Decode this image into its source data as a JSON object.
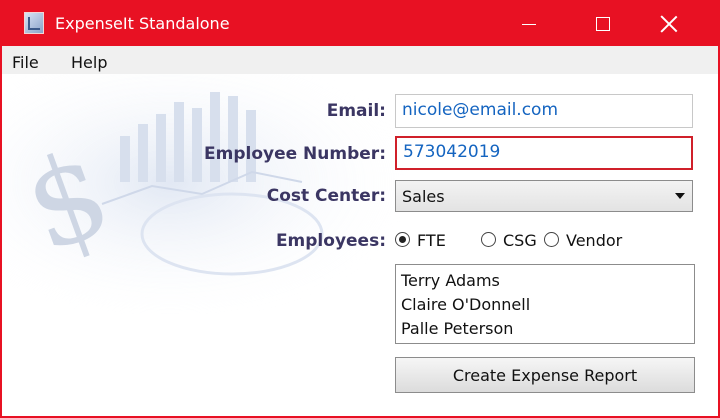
{
  "window": {
    "title": "ExpenseIt Standalone",
    "accent_color": "#e81123",
    "app_icon": "expenseit-app-icon",
    "controls": {
      "minimize": "minimize-icon",
      "maximize": "maximize-icon",
      "close": "close-icon"
    }
  },
  "menu": {
    "file": "File",
    "help": "Help"
  },
  "form": {
    "email_label": "Email:",
    "email_value": "nicole@email.com",
    "employee_number_label": "Employee Number:",
    "employee_number_value": "573042019",
    "cost_center_label": "Cost Center:",
    "cost_center_selected": "Sales",
    "employees_label": "Employees:",
    "employee_types": [
      {
        "label": "FTE",
        "checked": true
      },
      {
        "label": "CSG",
        "checked": false
      },
      {
        "label": "Vendor",
        "checked": false
      }
    ],
    "employee_list": [
      "Terry Adams",
      "Claire O'Donnell",
      "Palle Peterson"
    ],
    "create_button": "Create Expense Report"
  },
  "colors": {
    "label": "#3b3663",
    "input_text": "#1464c0",
    "focus_border": "#d0202a"
  }
}
